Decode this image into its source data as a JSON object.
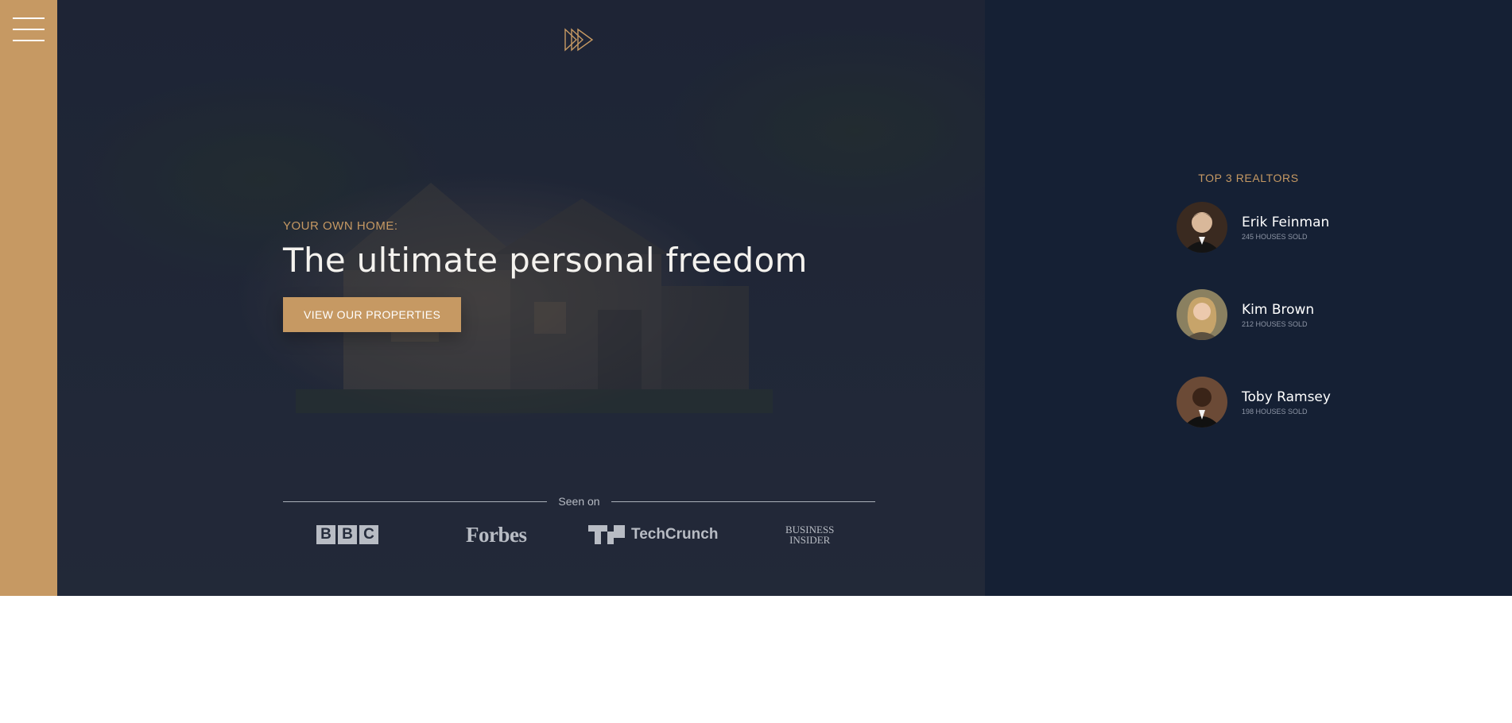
{
  "nav": {
    "menu_icon": "hamburger-menu-icon"
  },
  "brand": {
    "logo_icon": "triple-triangle-play-icon",
    "accent_color": "#c69963"
  },
  "hero": {
    "eyebrow": "YOUR OWN HOME:",
    "headline": "The ultimate personal freedom",
    "cta_label": "VIEW OUR PROPERTIES"
  },
  "seen_on": {
    "label": "Seen on",
    "logos": [
      "BBC",
      "Forbes",
      "TechCrunch",
      "Business Insider"
    ]
  },
  "realtors": {
    "title": "TOP 3 REALTORS",
    "items": [
      {
        "name": "Erik Feinman",
        "sold": "245 HOUSES SOLD"
      },
      {
        "name": "Kim Brown",
        "sold": "212 HOUSES SOLD"
      },
      {
        "name": "Toby Ramsey",
        "sold": "198 HOUSES SOLD"
      }
    ]
  },
  "colors": {
    "gold": "#c69963",
    "navy": "#152034",
    "hero_overlay": "#232a3b"
  }
}
